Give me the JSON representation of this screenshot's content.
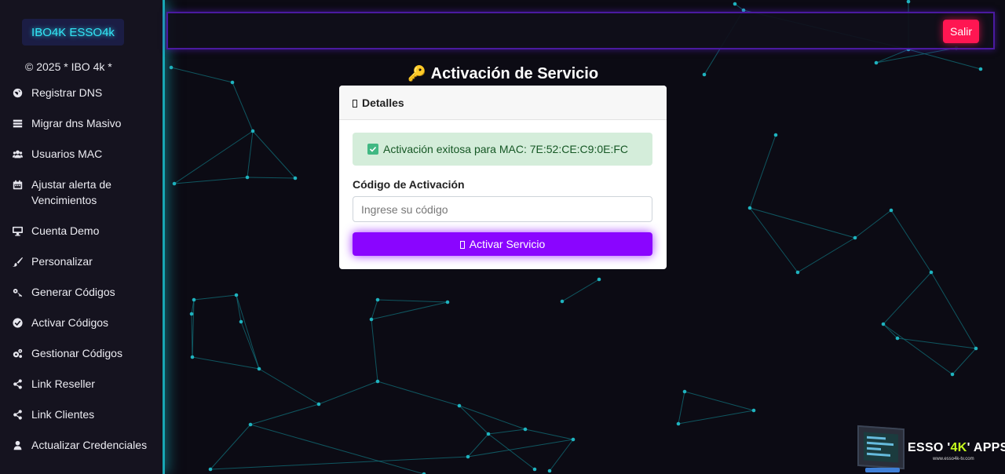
{
  "sidebar": {
    "brand": "IBO4K ESSO4k",
    "copyright": "© 2025 * IBO 4k *",
    "items": [
      {
        "label": "Registrar DNS",
        "icon": "globe-icon"
      },
      {
        "label": "Migrar dns Masivo",
        "icon": "server-icon"
      },
      {
        "label": "Usuarios MAC",
        "icon": "users-icon"
      },
      {
        "label": "Ajustar alerta de Vencimientos",
        "icon": "calendar-icon"
      },
      {
        "label": "Cuenta Demo",
        "icon": "desktop-icon"
      },
      {
        "label": "Personalizar",
        "icon": "brush-icon"
      },
      {
        "label": "Generar Códigos",
        "icon": "key-icon"
      },
      {
        "label": "Activar Códigos",
        "icon": "check-circle-icon"
      },
      {
        "label": "Gestionar Códigos",
        "icon": "gears-icon"
      },
      {
        "label": "Link Reseller",
        "icon": "share-icon"
      },
      {
        "label": "Link Clientes",
        "icon": "share-icon"
      },
      {
        "label": "Actualizar Credenciales",
        "icon": "user-icon"
      }
    ]
  },
  "header": {
    "logout_label": "Salir"
  },
  "main": {
    "title": "Activación de Servicio",
    "card_header": "Detalles",
    "alert": "Activación exitosa para MAC: 7E:52:CE:C9:0E:FC",
    "code_label": "Código de Activación",
    "code_placeholder": "Ingrese su código",
    "activate_label": "Activar Servicio"
  },
  "logo": {
    "text_prefix": "ESSO '",
    "text_highlight": "4K",
    "text_suffix": "' APPS",
    "subtitle": "www.esso4k-tv.com"
  },
  "colors": {
    "background": "#0c0b14",
    "sidebar_border": "#18a7b5",
    "header_border": "#4a1aa0",
    "logout": "#ff1652",
    "primary": "#8a05ff",
    "success_bg": "#d4edda",
    "success_text": "#155724"
  }
}
